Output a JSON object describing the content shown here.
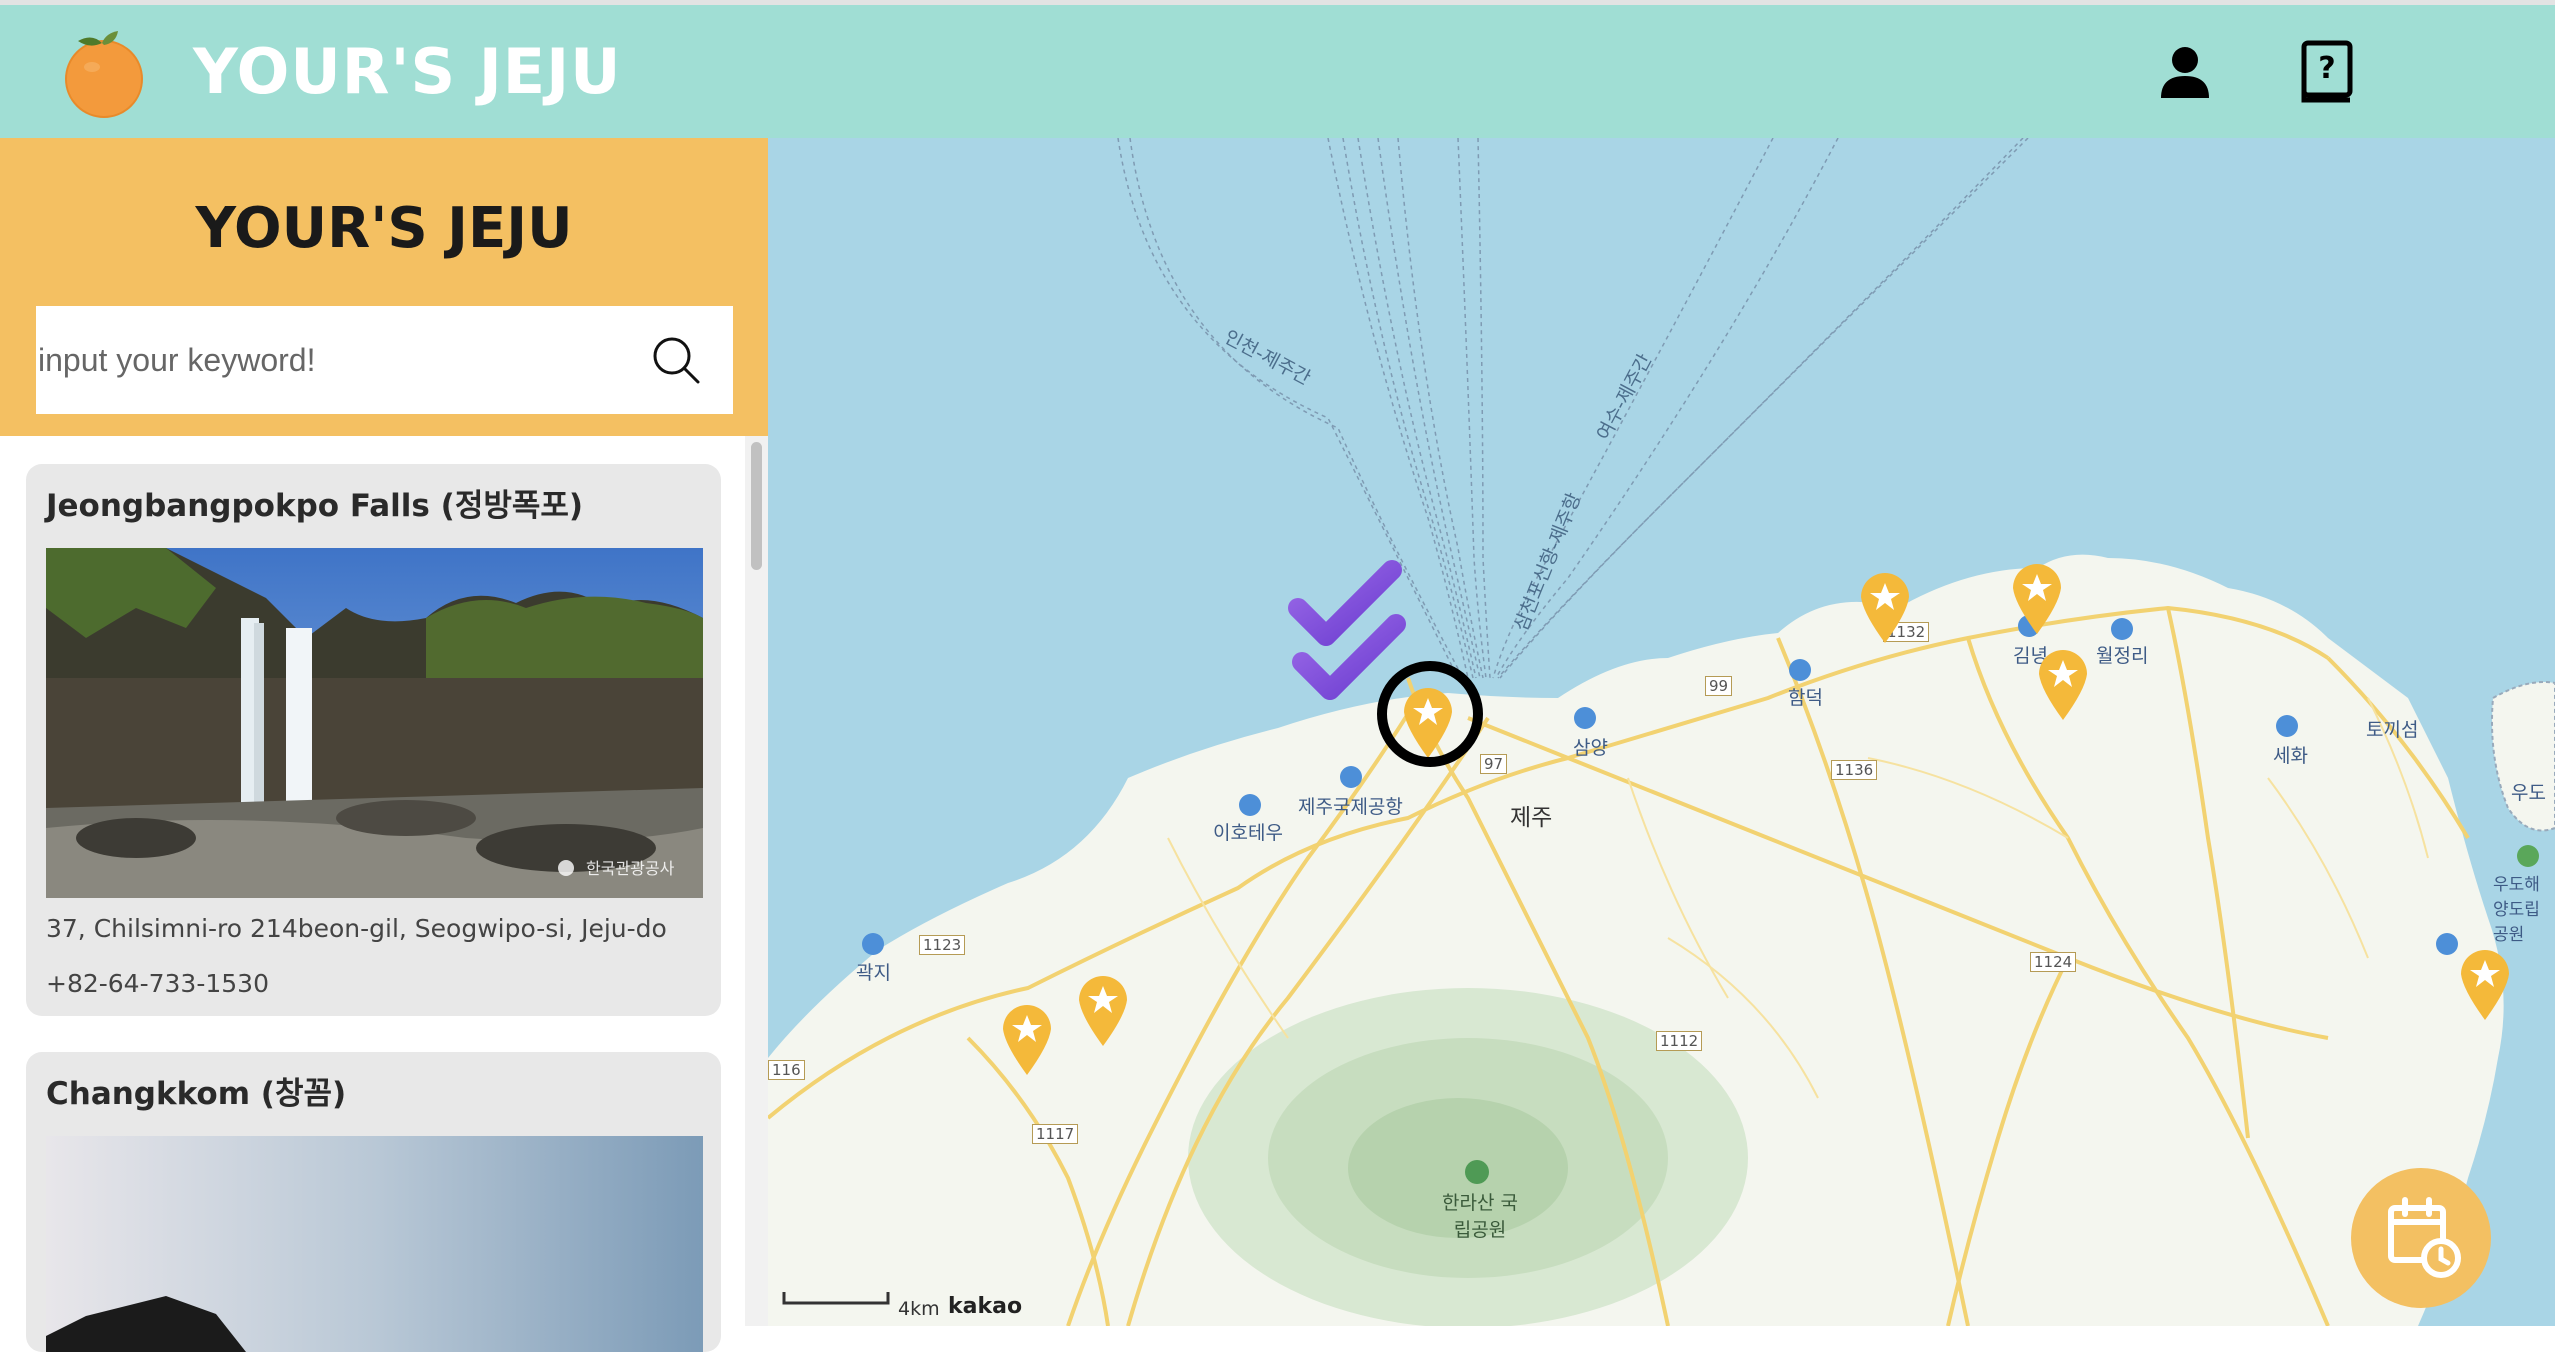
{
  "header": {
    "title": "YOUR'S JEJU",
    "icons": {
      "logo": "tangerine-logo",
      "user": "user-icon",
      "help": "help-book-icon"
    }
  },
  "sidebar": {
    "title": "YOUR'S JEJU",
    "search": {
      "placeholder": "input your keyword!",
      "value": "",
      "icon": "search-icon"
    },
    "places": [
      {
        "name": "Jeongbangpokpo Falls (정방폭포)",
        "address": "37, Chilsimni-ro 214beon-gil, Seogwipo-si, Jeju-do",
        "phone": "+82-64-733-1530",
        "photo_watermark": "한국관광공사"
      },
      {
        "name": "Changkkom (창꼼)"
      }
    ]
  },
  "map": {
    "route_labels": [
      "인천-제주간",
      "여수-제주간",
      "삼천포신항-제주항"
    ],
    "place_labels": [
      "제주국제공항",
      "이호테우",
      "제주",
      "삼양",
      "함덕",
      "김녕",
      "월정리",
      "세화",
      "토끼섬",
      "우도",
      "우도해양도립공원",
      "곽지",
      "한라산 국립공원"
    ],
    "road_numbers": [
      "97",
      "99",
      "1132",
      "1136",
      "1123",
      "1124",
      "1112",
      "1117",
      "116"
    ],
    "scale": "4km",
    "provider": "kakao",
    "marker_color": "#f4b93a",
    "icons": {
      "check": "double-check-icon",
      "fab": "calendar-clock-icon"
    }
  },
  "colors": {
    "header": "#a0ded4",
    "sidebar_top": "#f4c062",
    "card": "#e8e8e8",
    "sea": "#a9d5e6",
    "land": "#f4f6ef",
    "roads": "#f2d271"
  }
}
